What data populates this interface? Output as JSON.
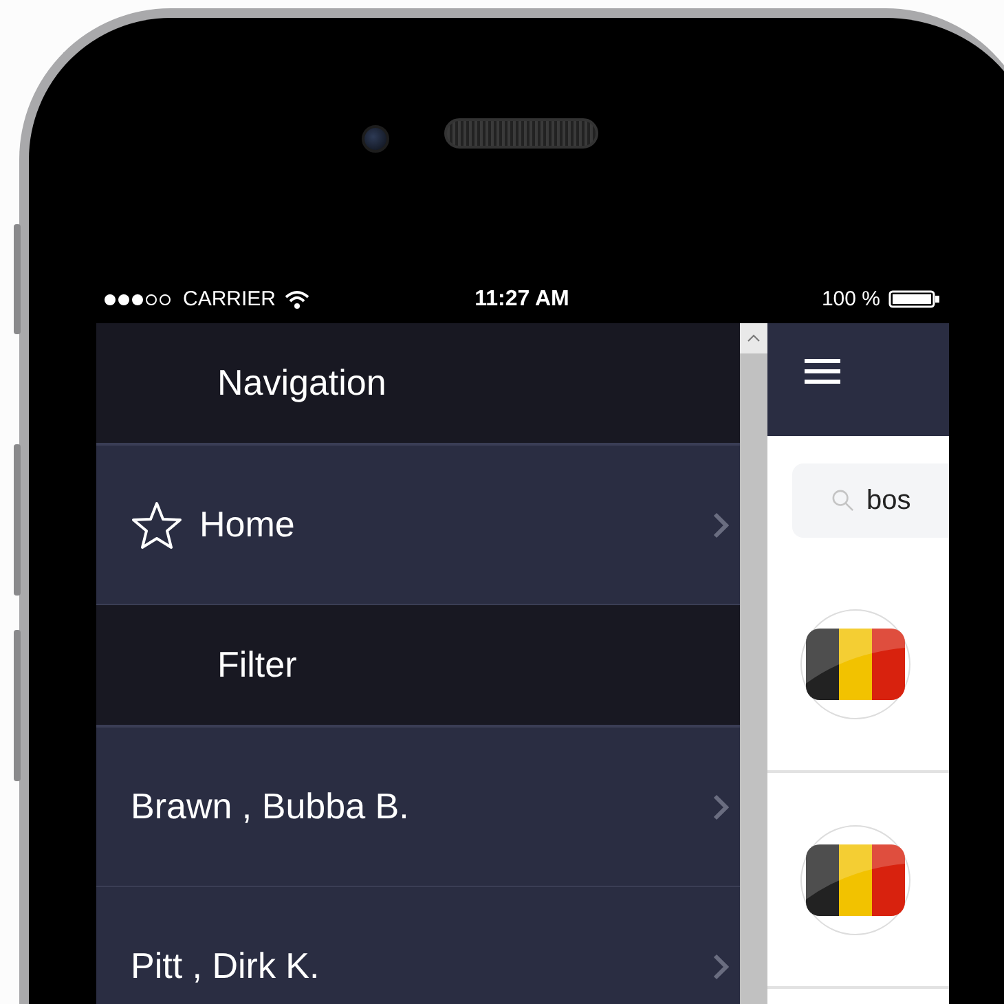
{
  "status_bar": {
    "carrier": "CARRIER",
    "time": "11:27 AM",
    "battery": "100 %"
  },
  "menu": [
    {
      "kind": "header",
      "label": "Navigation"
    },
    {
      "kind": "item",
      "label": "Home",
      "has_icon": true
    },
    {
      "kind": "header",
      "label": "Filter"
    },
    {
      "kind": "item",
      "label": "Brawn , Bubba B.",
      "has_icon": false
    },
    {
      "kind": "item",
      "label": "Pitt , Dirk K.",
      "has_icon": false
    }
  ],
  "search": {
    "value": "bos"
  },
  "results": [
    {
      "kind": "flag"
    },
    {
      "kind": "flag"
    }
  ]
}
